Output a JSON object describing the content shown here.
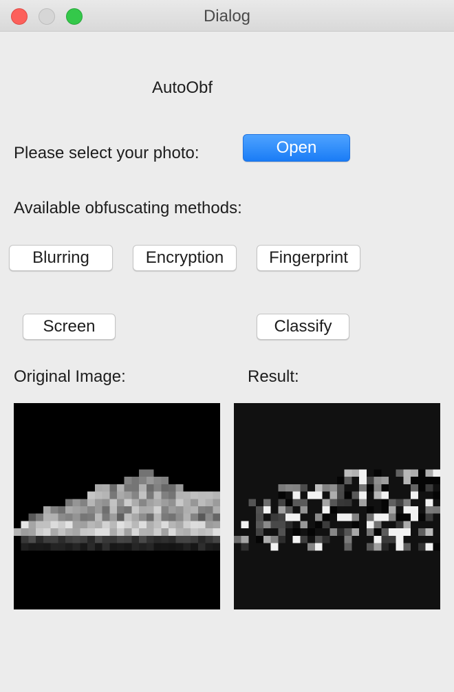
{
  "window": {
    "title": "Dialog"
  },
  "header": {
    "app_name": "AutoObf"
  },
  "select_photo": {
    "label": "Please select your photo:",
    "open_label": "Open"
  },
  "methods": {
    "label": "Available obfuscating methods:",
    "buttons": [
      "Blurring",
      "Encryption",
      "Fingerprint",
      "Screen",
      "Classify"
    ]
  },
  "panels": {
    "original_label": "Original Image:",
    "result_label": "Result:"
  },
  "colors": {
    "accent": "#1a7cf6",
    "window_bg": "#ececec",
    "original_bg": "#000000",
    "result_bg": "#111111"
  }
}
